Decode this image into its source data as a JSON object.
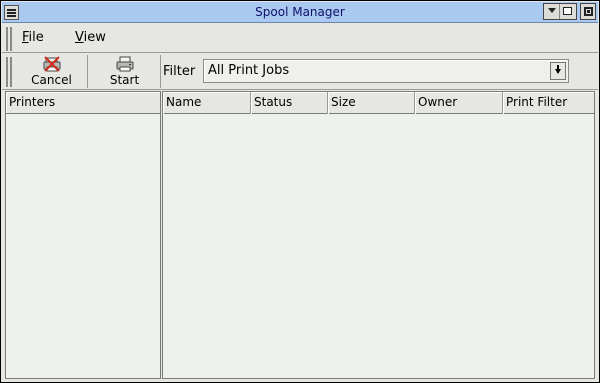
{
  "window": {
    "title": "Spool Manager"
  },
  "menubar": {
    "items": [
      "File",
      "View"
    ],
    "mnemonics": [
      "F",
      "V"
    ]
  },
  "toolbar": {
    "cancel_label": "Cancel",
    "cancel_icon": "cancel-print-icon",
    "start_label": "Start",
    "start_icon": "printer-icon",
    "filter_label": "Filter",
    "filter_value": "All Print Jobs"
  },
  "printers": {
    "header": "Printers",
    "items": []
  },
  "jobs": {
    "columns": [
      "Name",
      "Status",
      "Size",
      "Owner",
      "Print Filter"
    ],
    "rows": []
  }
}
